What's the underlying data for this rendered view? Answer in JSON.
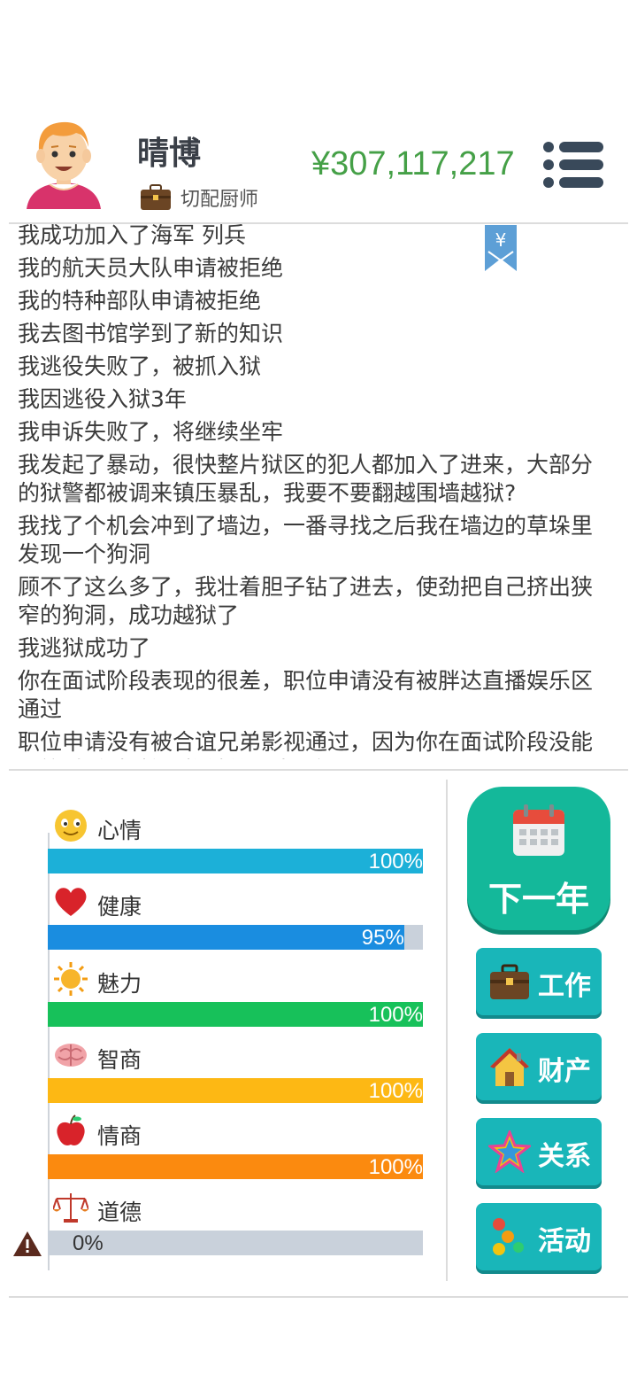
{
  "profile": {
    "name": "晴博",
    "job": "切配厨师",
    "money": "¥307,117,217"
  },
  "log": [
    "我成功加入了海军 列兵",
    "我的航天员大队申请被拒绝",
    "我的特种部队申请被拒绝",
    "我去图书馆学到了新的知识",
    "我逃役失败了，被抓入狱",
    "我因逃役入狱3年",
    "我申诉失败了，将继续坐牢",
    "我发起了暴动，很快整片狱区的犯人都加入了进来，大部分的狱警都被调来镇压暴乱，我要不要翻越围墙越狱?",
    "我找了个机会冲到了墙边，一番寻找之后我在墙边的草垛里发现一个狗洞",
    "顾不了这么多了，我壮着胆子钻了进去，使劲把自己挤出狭窄的狗洞，成功越狱了",
    "我逃狱成功了",
    "你在面试阶段表现的很差，职位申请没有被胖达直播娱乐区通过",
    "职位申请没有被合谊兄弟影视通过，因为你在面试阶段没能回答“如何把控子推销给和尚”这个问题"
  ],
  "bookmark_symbol": "¥",
  "stats": [
    {
      "label": "心情",
      "icon": "smiley-icon",
      "value": 100,
      "text": "100%",
      "color": "#1cb0d8"
    },
    {
      "label": "健康",
      "icon": "heart-icon",
      "value": 95,
      "text": "95%",
      "color": "#1a8de0"
    },
    {
      "label": "魅力",
      "icon": "sun-icon",
      "value": 100,
      "text": "100%",
      "color": "#17c15a"
    },
    {
      "label": "智商",
      "icon": "brain-icon",
      "value": 100,
      "text": "100%",
      "color": "#fdb814"
    },
    {
      "label": "情商",
      "icon": "apple-icon",
      "value": 100,
      "text": "100%",
      "color": "#fb8a0f"
    },
    {
      "label": "道德",
      "icon": "scales-icon",
      "value": 0,
      "text": "0%",
      "color": "#c9d1db"
    }
  ],
  "buttons": {
    "next_year": "下一年",
    "work": "工作",
    "assets": "财产",
    "relations": "关系",
    "activities": "活动"
  },
  "colors": {
    "money": "#45a047",
    "next_year_bg": "#14b89a",
    "side_button_bg": "#19b6b9"
  }
}
